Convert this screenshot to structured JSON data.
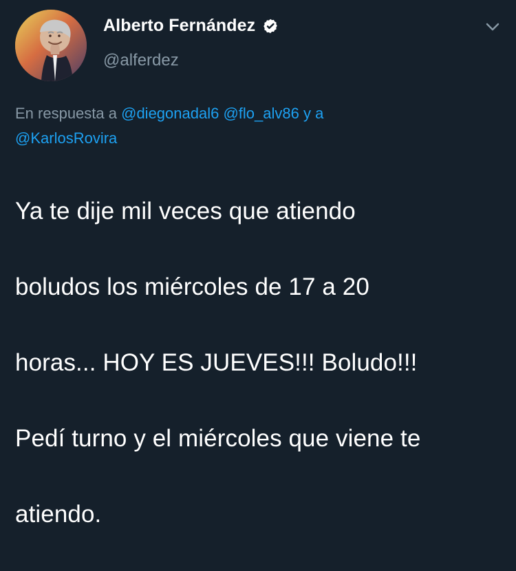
{
  "tweet": {
    "display_name": "Alberto Fernández",
    "handle": "@alferdez",
    "reply": {
      "prefix": "En respuesta a",
      "mentions": [
        "@diegonadal6",
        "@flo_alv86",
        "@KarlosRovira"
      ],
      "connector": "y a"
    },
    "text_lines": [
      "Ya te dije mil veces que atiendo",
      "boludos los miércoles de 17 a 20",
      "horas... HOY ES JUEVES!!! Boludo!!!",
      "Pedí turno y el miércoles que viene te",
      "atiendo."
    ]
  },
  "icons": {
    "verified": "verified-badge-icon",
    "more": "chevron-down-icon"
  },
  "colors": {
    "background": "#15202b",
    "primary_text": "#ffffff",
    "secondary_text": "#8899a6",
    "link": "#1da1f2"
  }
}
